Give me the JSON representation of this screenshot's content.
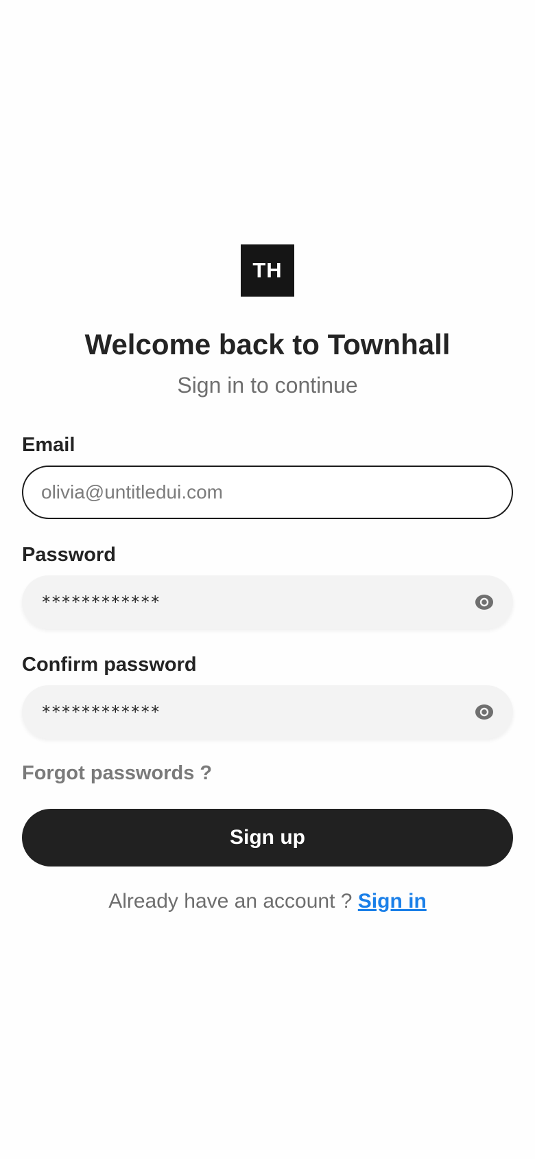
{
  "logo": {
    "text": "TH",
    "bg_color": "#151515"
  },
  "header": {
    "title": "Welcome back to Townhall",
    "subtitle": "Sign in to continue"
  },
  "form": {
    "email": {
      "label": "Email",
      "placeholder": "olivia@untitledui.com",
      "value": ""
    },
    "password": {
      "label": "Password",
      "masked_value": "************",
      "toggle_icon": "eye-icon"
    },
    "confirm_password": {
      "label": "Confirm password",
      "masked_value": "************",
      "toggle_icon": "eye-icon"
    },
    "forgot_label": "Forgot passwords ?",
    "submit_label": "Sign up"
  },
  "footer": {
    "prompt": "Already have an account ?",
    "link_label": "Sign in",
    "link_color": "#1a7fe8"
  }
}
